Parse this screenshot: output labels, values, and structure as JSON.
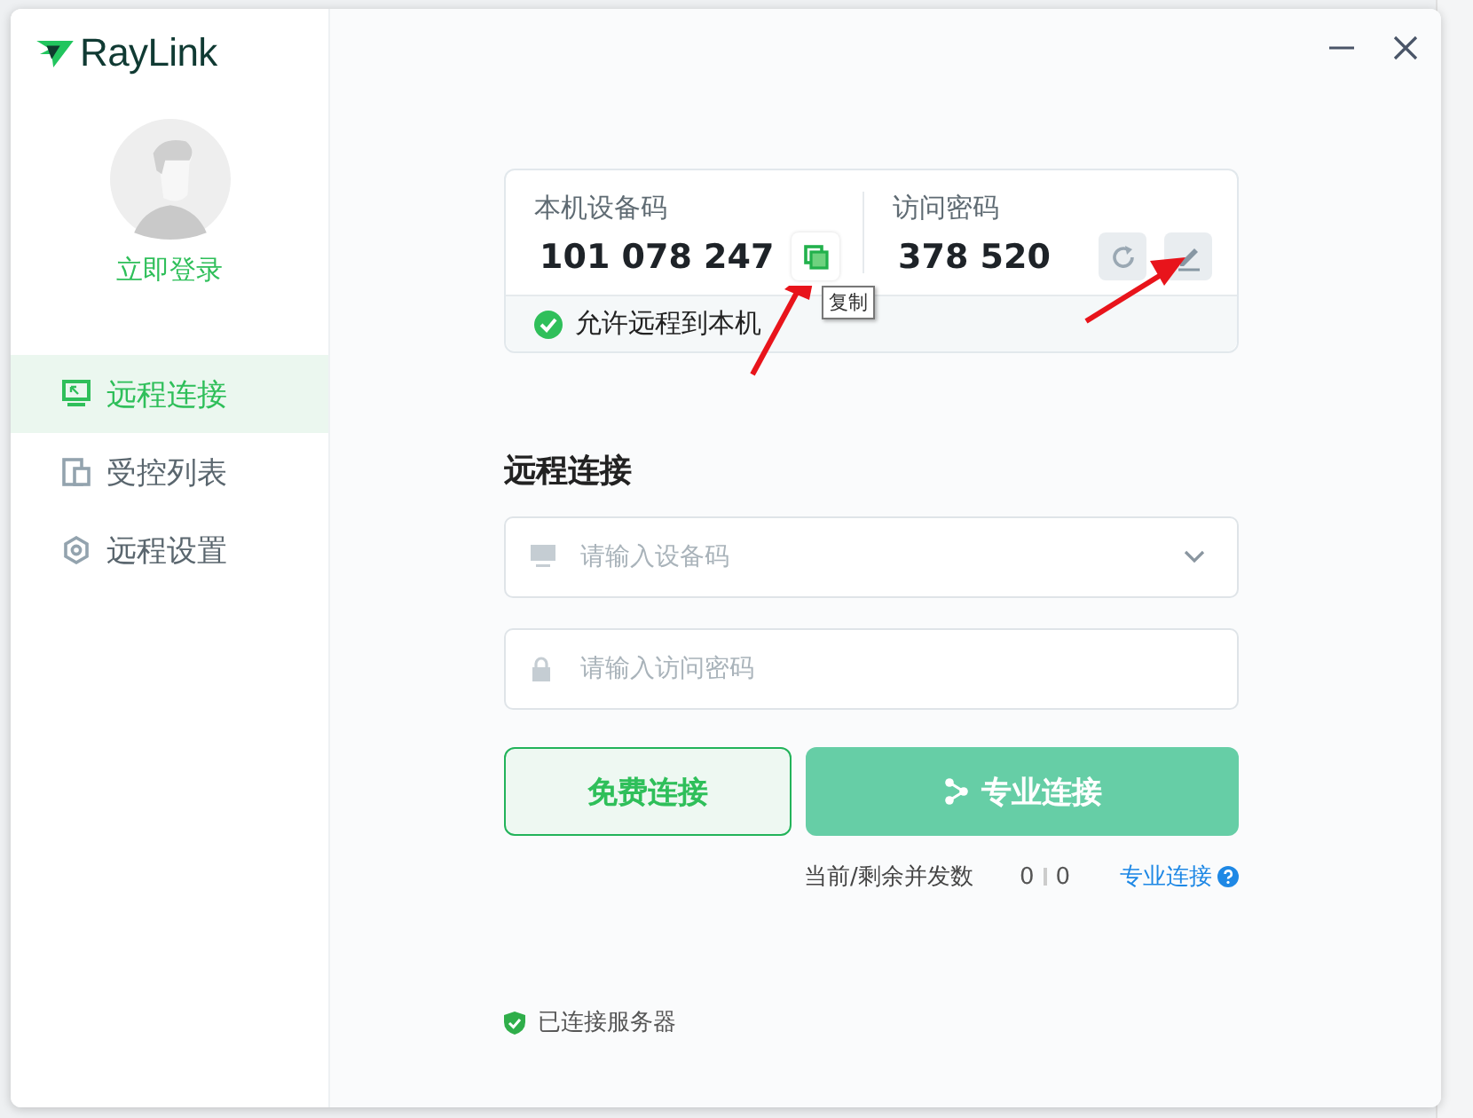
{
  "app": {
    "logo": "RayLink",
    "login": "立即登录"
  },
  "nav": [
    {
      "label": "远程连接",
      "kind": "monitor",
      "selected": true
    },
    {
      "label": "受控列表",
      "kind": "devices",
      "selected": false
    },
    {
      "label": "远程设置",
      "kind": "settings",
      "selected": false
    }
  ],
  "codes": {
    "device_label": "本机设备码",
    "device_code": "101 078 247",
    "copy_tooltip": "复制",
    "password_label": "访问密码",
    "password": "378 520",
    "allow_remote": {
      "label": "允许远程到本机",
      "checked": true
    }
  },
  "connect": {
    "title": "远程连接",
    "device_field": {
      "placeholder": "请输入设备码"
    },
    "password_field": {
      "placeholder": "请输入访问密码"
    },
    "free_button": "免费连接",
    "pro_button": "专业连接",
    "concurrency_label": "当前/剩余并发数",
    "current": "0",
    "remaining": "0",
    "pro_link": "专业连接"
  },
  "status": {
    "label": "已连接服务器",
    "connected": true
  }
}
